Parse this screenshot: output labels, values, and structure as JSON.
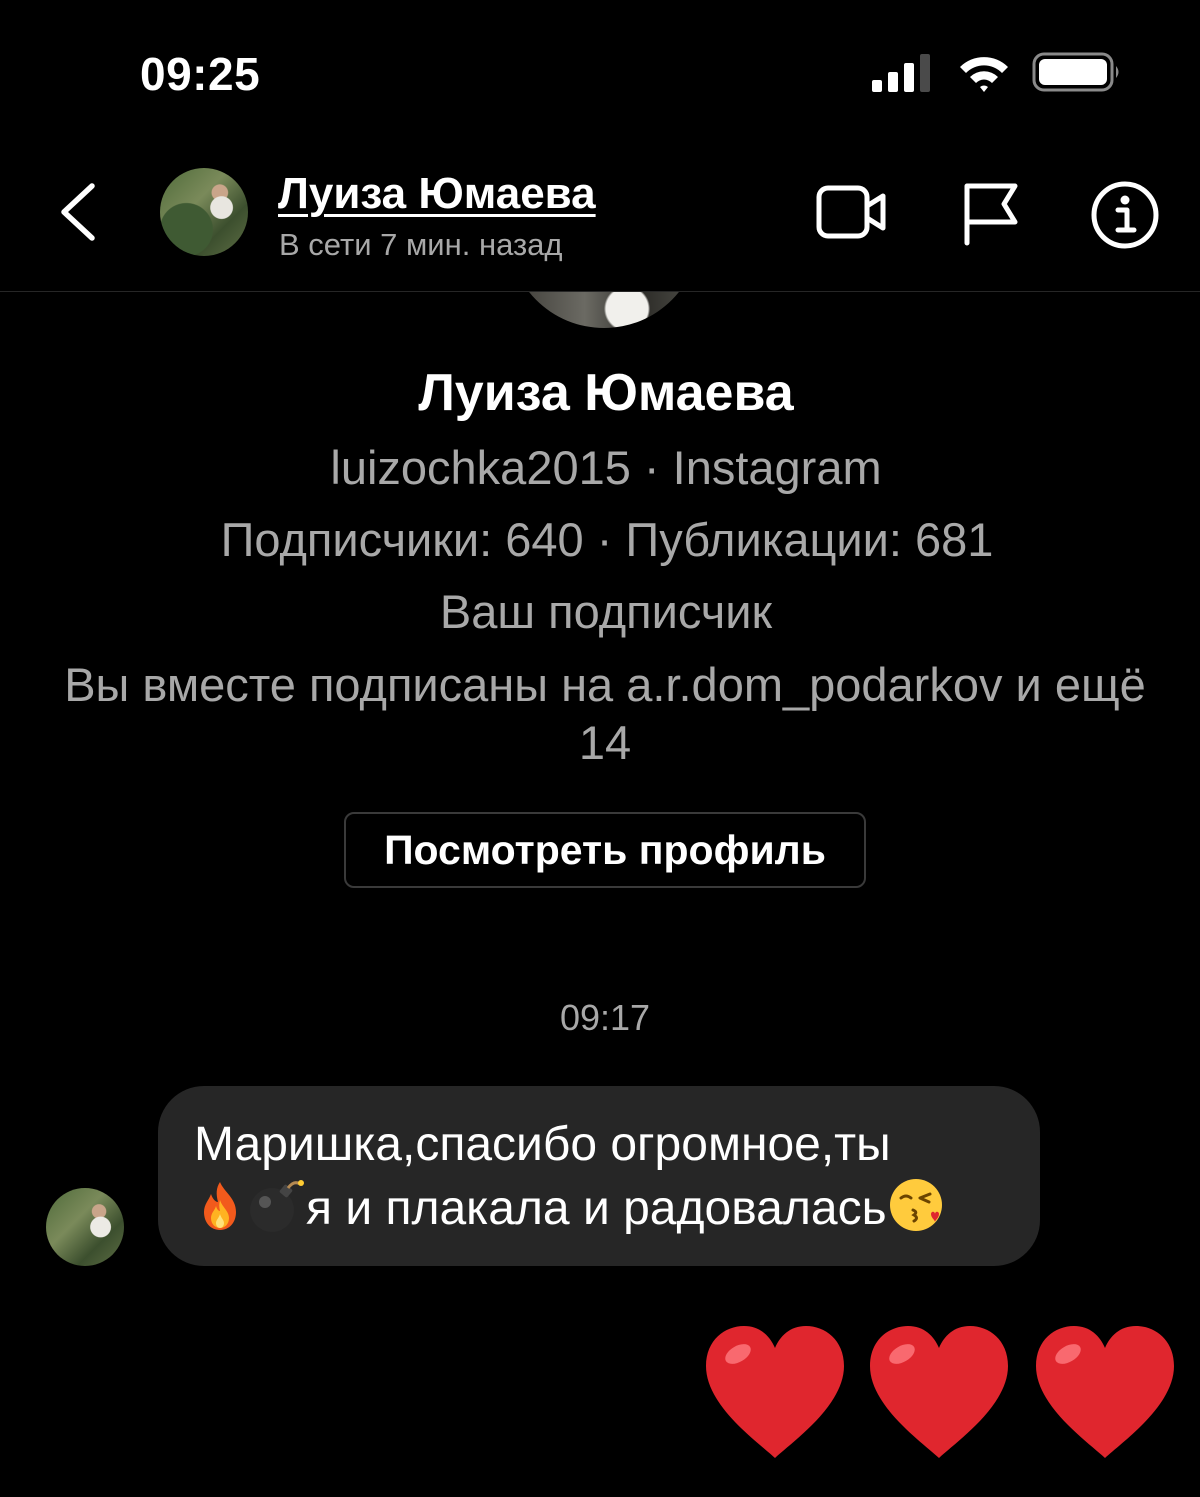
{
  "status_bar": {
    "time": "09:25"
  },
  "header": {
    "contact_name": "Луиза Юмаева",
    "contact_status": "В сети 7 мин. назад"
  },
  "profile": {
    "name": "Луиза Юмаева",
    "handle_line": "luizochka2015 · Instagram",
    "stats_line": "Подписчики: 640 · Публикации: 681",
    "follow_status": "Ваш подписчик",
    "mutual_line": "Вы вместе подписаны на a.r.dom_podarkov и ещё 14",
    "view_profile_label": "Посмотреть профиль"
  },
  "conversation": {
    "timestamp": "09:17",
    "messages": [
      {
        "line1": "Маришка,спасибо огромное,ты",
        "line2_text": "я и плакала и радовалась",
        "emojis": [
          "fire-emoji",
          "bomb-emoji",
          "kissing-face-emoji"
        ]
      }
    ],
    "reaction_emojis": [
      "red-heart-emoji",
      "red-heart-emoji",
      "red-heart-emoji"
    ]
  },
  "colors": {
    "background": "#000000",
    "primary_text": "#ffffff",
    "secondary_text": "#a8a8a8",
    "bubble": "#262626",
    "heart_red": "#e0262e"
  }
}
